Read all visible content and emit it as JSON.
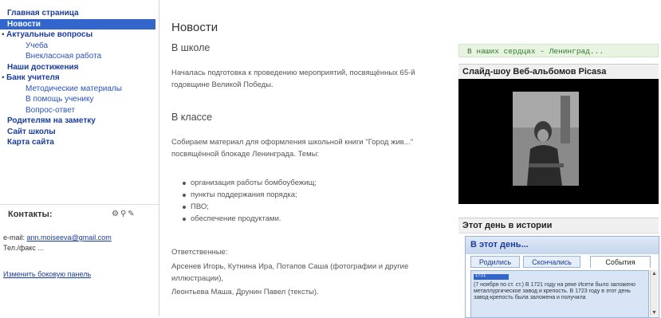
{
  "sidebar": {
    "items": [
      {
        "label": "Главная страница",
        "level": 1,
        "active": false
      },
      {
        "label": "Новости",
        "level": 1,
        "active": true
      },
      {
        "label": "Актуальные вопросы",
        "level": 1,
        "active": false,
        "expanded": true
      },
      {
        "label": "Учеба",
        "level": 2,
        "active": false
      },
      {
        "label": "Внеклассная работа",
        "level": 2,
        "active": false
      },
      {
        "label": "Наши достижения",
        "level": 1,
        "active": false
      },
      {
        "label": "Банк учителя",
        "level": 1,
        "active": false,
        "expanded": true
      },
      {
        "label": "Методические материалы",
        "level": 2,
        "active": false
      },
      {
        "label": "В помощь ученику",
        "level": 2,
        "active": false
      },
      {
        "label": "Вопрос-ответ",
        "level": 2,
        "active": false
      },
      {
        "label": "Родителям на заметку",
        "level": 1,
        "active": false
      },
      {
        "label": "Сайт школы",
        "level": 1,
        "active": false
      },
      {
        "label": "Карта сайта",
        "level": 1,
        "active": false
      }
    ]
  },
  "contacts": {
    "title": "Контакты:",
    "email_label": "e-mail:",
    "email": "ann.moiseeva@gmail.com",
    "phone": "Тел./факс ...",
    "edit_link": "Изменить боковую панель"
  },
  "main": {
    "title": "Новости",
    "section1_heading": "В школе",
    "section1_text": "Началась подготовка к проведению мероприятий, посвящённых 65-й годовщине Великой Победы.",
    "section2_heading": "В классе",
    "section2_text": "Собираем материал для оформления школьной книги \"Город жив...\" посвящённой блокаде Ленинграда. Темы:",
    "topics": [
      "организация работы бомбоубежищ;",
      "пункты поддержания порядка;",
      "ПВО;",
      "обеспечение продуктами."
    ],
    "responsible_label": "Ответственные:",
    "responsible_text": "Арсенев Игорь, Кутнина Ира, Потапов Саша (фотографии и другие иллюстрации),",
    "responsible_text2": "Леонтьева Маша, Друнин Павел (тексты)."
  },
  "right": {
    "ticker": "В наших сердцах - Ленинград...",
    "slideshow_title": "Слайд-шоу Веб-альбомов Picasa",
    "history_title": "Этот день в истории",
    "widget_header": "В этот день...",
    "tabs": [
      "Родились",
      "Скончались",
      "События"
    ],
    "year": "1721",
    "event_text": "(7 ноября по ст. ст.) В 1721 году на реке Исети было заложено металлургическое завод и крепость. В 1723 году в этот день завод-крепость была заложена и получила"
  },
  "colors": {
    "link": "#1a3d9c",
    "active_nav": "#3366cc",
    "ticker_bg": "#e8f4e1",
    "ticker_text": "#2e7a2e"
  }
}
